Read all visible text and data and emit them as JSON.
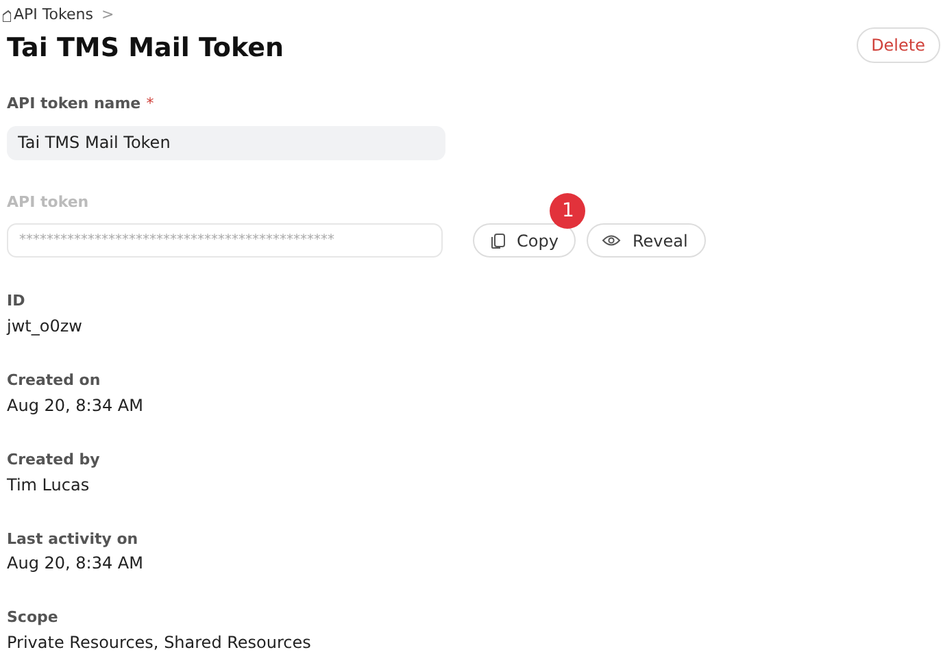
{
  "breadcrumb": {
    "label": "API Tokens",
    "separator": ">"
  },
  "title": "Tai TMS Mail Token",
  "delete_button": "Delete",
  "name_field": {
    "label": "API token name",
    "required_mark": "*",
    "value": "Tai TMS Mail Token"
  },
  "token_field": {
    "label": "API token",
    "value": "**********************************************",
    "disabled": true
  },
  "copy_button": {
    "label": "Copy",
    "badge": "1"
  },
  "reveal_button": "Reveal",
  "details": [
    {
      "label": "ID",
      "value": "jwt_o0zw"
    },
    {
      "label": "Created on",
      "value": "Aug 20, 8:34 AM"
    },
    {
      "label": "Created by",
      "value": "Tim Lucas"
    },
    {
      "label": "Last activity on",
      "value": "Aug 20, 8:34 AM"
    },
    {
      "label": "Scope",
      "value": "Private Resources, Shared Resources"
    }
  ]
}
